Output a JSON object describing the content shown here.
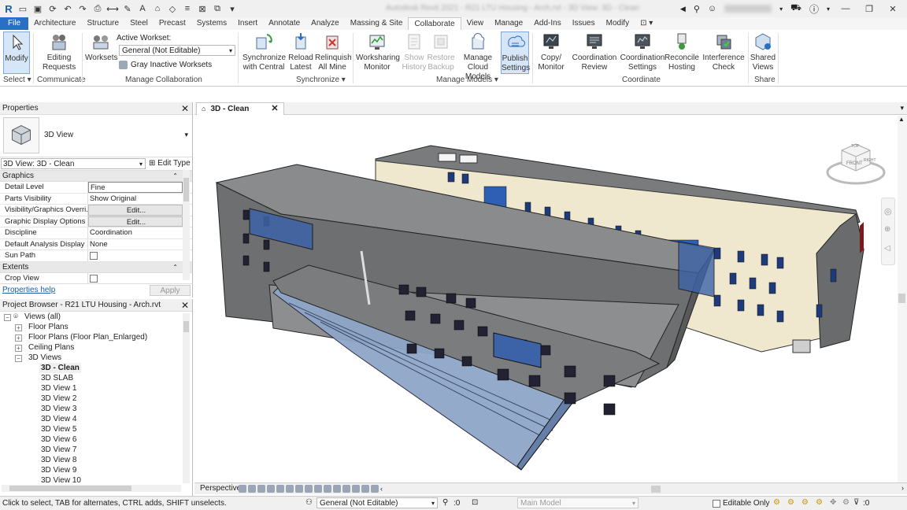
{
  "titlebar": {
    "logo": "R",
    "title": "Autodesk Revit 2021 - R21 LTU Housing - Arch.rvt - 3D View: 3D - Clean"
  },
  "tabs": [
    "File",
    "Architecture",
    "Structure",
    "Steel",
    "Precast",
    "Systems",
    "Insert",
    "Annotate",
    "Analyze",
    "Massing & Site",
    "Collaborate",
    "View",
    "Manage",
    "Add-Ins",
    "Issues",
    "Modify"
  ],
  "active_tab": "Collaborate",
  "ribbon": {
    "modify": "Modify",
    "editing_requests_1": "Editing",
    "editing_requests_2": "Requests",
    "worksets": "Worksets",
    "active_workset_label": "Active Workset:",
    "active_workset_value": "General (Not Editable)",
    "gray_inactive": "Gray Inactive Worksets",
    "sync_central_1": "Synchronize",
    "sync_central_2": "with Central",
    "reload_1": "Reload",
    "reload_2": "Latest",
    "relinquish_1": "Relinquish",
    "relinquish_2": "All Mine",
    "ws_monitor_1": "Worksharing",
    "ws_monitor_2": "Monitor",
    "show_history_1": "Show",
    "show_history_2": "History",
    "restore_1": "Restore",
    "restore_2": "Backup",
    "manage_cloud_1": "Manage",
    "manage_cloud_2": "Cloud Models",
    "publish_1": "Publish",
    "publish_2": "Settings",
    "copy_monitor_1": "Copy/",
    "copy_monitor_2": "Monitor",
    "coord_review_1": "Coordination",
    "coord_review_2": "Review",
    "coord_settings_1": "Coordination",
    "coord_settings_2": "Settings",
    "reconcile_1": "Reconcile",
    "reconcile_2": "Hosting",
    "interference_1": "Interference",
    "interference_2": "Check",
    "shared_views_1": "Shared",
    "shared_views_2": "Views",
    "panels": {
      "select": "Select",
      "communicate": "Communicate",
      "manage_collab": "Manage Collaboration",
      "synchronize": "Synchronize",
      "manage_models": "Manage Models",
      "coordinate": "Coordinate",
      "share": "Share"
    }
  },
  "properties": {
    "title": "Properties",
    "type": "3D View",
    "selector": "3D View: 3D - Clean",
    "edit_type": "Edit Type",
    "graphics": "Graphics",
    "extents": "Extents",
    "rows": [
      {
        "k": "Detail Level",
        "v": "Fine"
      },
      {
        "k": "Parts Visibility",
        "v": "Show Original"
      },
      {
        "k": "Visibility/Graphics Overri...",
        "v": "Edit..."
      },
      {
        "k": "Graphic Display Options",
        "v": "Edit..."
      },
      {
        "k": "Discipline",
        "v": "Coordination"
      },
      {
        "k": "Default Analysis Display ...",
        "v": "None"
      },
      {
        "k": "Sun Path",
        "v": ""
      }
    ],
    "crop_view": "Crop View",
    "help": "Properties help",
    "apply": "Apply"
  },
  "browser": {
    "title": "Project Browser - R21 LTU Housing - Arch.rvt",
    "items": [
      "Views (all)",
      "Floor Plans",
      "Floor Plans (Floor Plan_Enlarged)",
      "Ceiling Plans",
      "3D Views",
      "3D - Clean",
      "3D SLAB",
      "3D View 1",
      "3D View 2",
      "3D View 3",
      "3D View 4",
      "3D View 5",
      "3D View 6",
      "3D View 7",
      "3D View 8",
      "3D View 9",
      "3D View 10"
    ]
  },
  "view": {
    "tab": "3D - Clean",
    "cube_front": "FRONT",
    "cube_top": "TOP",
    "cube_right": "RIGHT"
  },
  "viewbar": {
    "perspective": "Perspective"
  },
  "status": {
    "message": "Click to select, TAB for alternates, CTRL adds, SHIFT unselects.",
    "workset": "General (Not Editable)",
    "count": ":0",
    "main_model": "Main Model",
    "editable_only": "Editable Only",
    "filter": ":0"
  }
}
